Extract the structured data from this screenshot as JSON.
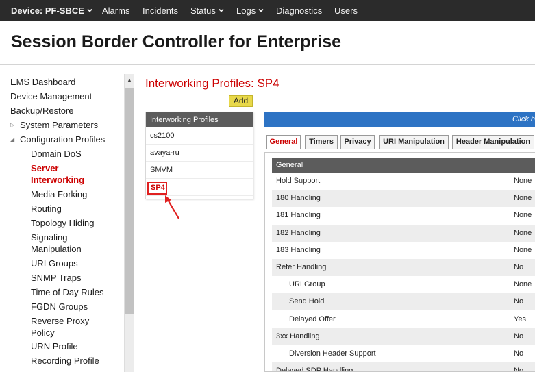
{
  "nav": {
    "device": "Device: PF-SBCE",
    "items": [
      "Alarms",
      "Incidents",
      "Status",
      "Logs",
      "Diagnostics",
      "Users"
    ]
  },
  "page_title": "Session Border Controller for Enterprise",
  "sidebar": {
    "items": [
      {
        "label": "EMS Dashboard"
      },
      {
        "label": "Device Management"
      },
      {
        "label": "Backup/Restore"
      },
      {
        "label": "System Parameters",
        "expander": "collapsed"
      },
      {
        "label": "Configuration Profiles",
        "expander": "expanded"
      },
      {
        "label": "Domain DoS"
      },
      {
        "label": "Server Interworking",
        "active": true
      },
      {
        "label": "Media Forking"
      },
      {
        "label": "Routing"
      },
      {
        "label": "Topology Hiding"
      },
      {
        "label": "Signaling Manipulation"
      },
      {
        "label": "URI Groups"
      },
      {
        "label": "SNMP Traps"
      },
      {
        "label": "Time of Day Rules"
      },
      {
        "label": "FGDN Groups"
      },
      {
        "label": "Reverse Proxy Policy"
      },
      {
        "label": "URN Profile"
      },
      {
        "label": "Recording Profile"
      }
    ]
  },
  "main": {
    "section_title": "Interworking Profiles: SP4",
    "add_label": "Add",
    "profiles": {
      "header": "Interworking Profiles",
      "items": [
        "cs2100",
        "avaya-ru",
        "SMVM",
        "SP4"
      ],
      "selected": "SP4"
    },
    "banner_text": "Click h",
    "tabs": [
      "General",
      "Timers",
      "Privacy",
      "URI Manipulation",
      "Header Manipulation"
    ],
    "active_tab": "General",
    "table_header": "General",
    "rows": [
      {
        "label": "Hold Support",
        "value": "None"
      },
      {
        "label": "180 Handling",
        "value": "None"
      },
      {
        "label": "181 Handling",
        "value": "None"
      },
      {
        "label": "182 Handling",
        "value": "None"
      },
      {
        "label": "183 Handling",
        "value": "None"
      },
      {
        "label": "Refer Handling",
        "value": "No"
      },
      {
        "label": "URI Group",
        "value": "None",
        "indent": true
      },
      {
        "label": "Send Hold",
        "value": "No",
        "indent": true
      },
      {
        "label": "Delayed Offer",
        "value": "Yes",
        "indent": true
      },
      {
        "label": "3xx Handling",
        "value": "No"
      },
      {
        "label": "Diversion Header Support",
        "value": "No",
        "indent": true
      },
      {
        "label": "Delayed SDP Handling",
        "value": "No"
      }
    ]
  },
  "colors": {
    "accent_red": "#cc0000",
    "nav_bg": "#2b2b2b",
    "header_gray": "#5c5c5c",
    "banner_blue": "#2d73c4",
    "add_yellow": "#e8d84a"
  }
}
